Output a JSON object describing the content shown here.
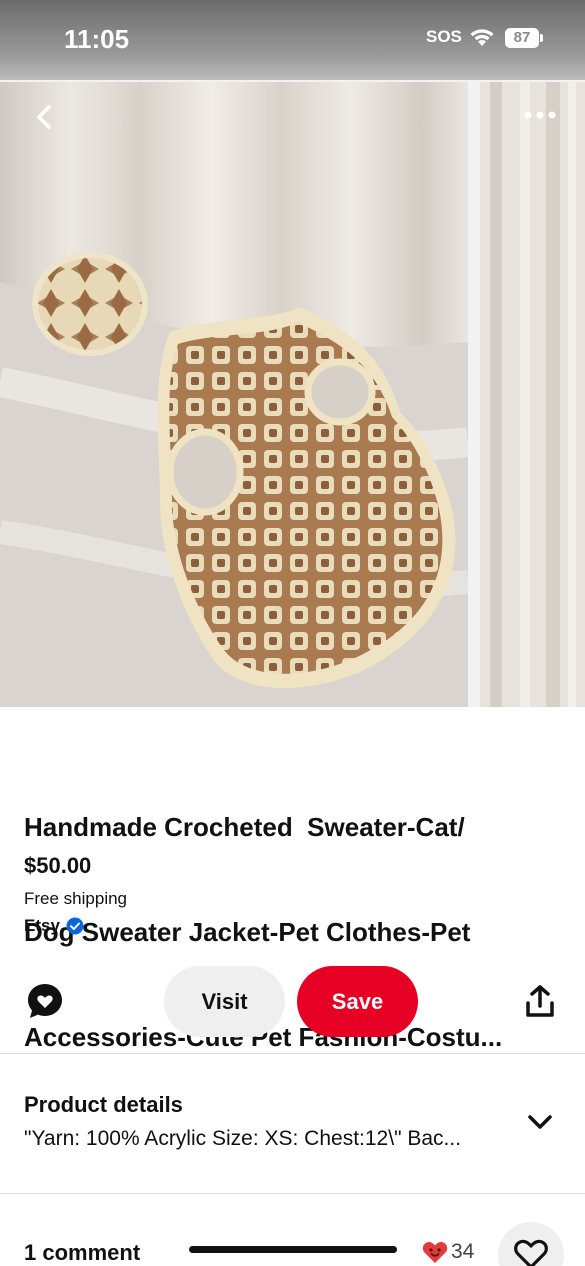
{
  "status_bar": {
    "time": "11:05",
    "sos": "SOS",
    "battery": "87"
  },
  "pin": {
    "title_lines": [
      "Handmade Crocheted  Sweater-Cat/",
      "Dog Sweater Jacket-Pet Clothes-Pet",
      "Accessories-Cute Pet Fashion-Costu..."
    ],
    "price": "$50.00",
    "shipping": "Free shipping",
    "seller": "Etsy"
  },
  "actions": {
    "visit_label": "Visit",
    "save_label": "Save"
  },
  "details": {
    "title": "Product details",
    "text": "\"Yarn: 100% Acrylic Size: XS: Chest:12\\\" Bac..."
  },
  "comments": {
    "count_label": "1 comment",
    "reaction_count": "34"
  },
  "icons": {
    "back": "chevron-left-icon",
    "more": "more-horizontal-icon",
    "comment": "comment-bubble-icon",
    "share": "share-icon",
    "chevron": "chevron-down-icon",
    "like": "heart-outline-icon",
    "verified": "verified-check-icon"
  },
  "colors": {
    "save": "#e60023",
    "verified": "#0a66e0",
    "visit_bg": "#efefef"
  }
}
